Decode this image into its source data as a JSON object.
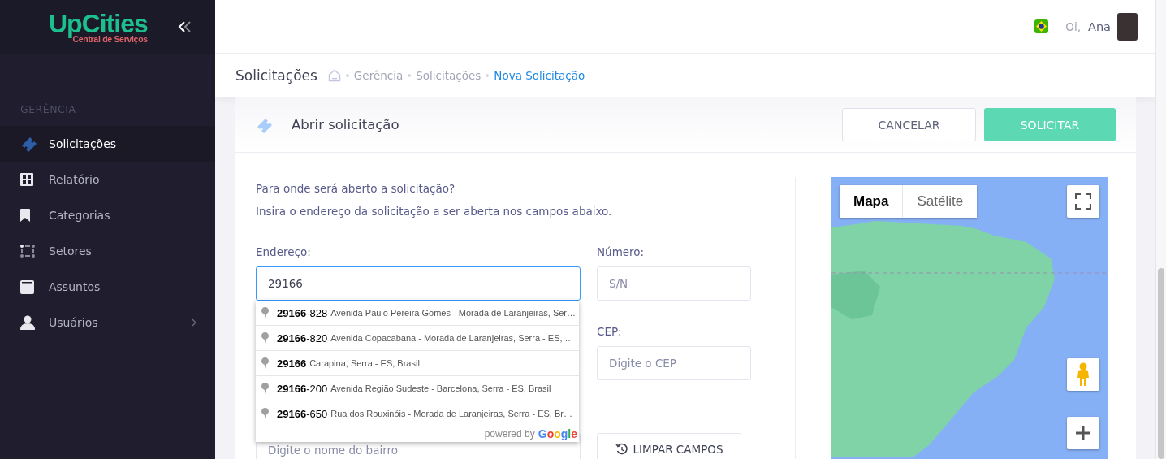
{
  "sidebar": {
    "logo": {
      "name": "UpCities",
      "tagline": "Central de Serviços"
    },
    "section_title": "GERÊNCIA",
    "items": [
      {
        "label": "Solicitações",
        "selected": true,
        "expandable": false
      },
      {
        "label": "Relatório",
        "selected": false,
        "expandable": false
      },
      {
        "label": "Categorias",
        "selected": false,
        "expandable": false
      },
      {
        "label": "Setores",
        "selected": false,
        "expandable": false
      },
      {
        "label": "Assuntos",
        "selected": false,
        "expandable": false
      },
      {
        "label": "Usuários",
        "selected": false,
        "expandable": true
      }
    ]
  },
  "header": {
    "greeting": "Oi,",
    "user_name": "Ana"
  },
  "breadcrumb": {
    "title": "Solicitações",
    "items": [
      {
        "label": "Gerência",
        "selected": false
      },
      {
        "label": "Solicitações",
        "selected": false
      },
      {
        "label": "Nova Solicitação",
        "selected": true
      }
    ]
  },
  "card": {
    "title": "Abrir solicitação",
    "buttons": [
      {
        "label": "CANCELAR",
        "kind": "secondary"
      },
      {
        "label": "SOLICITAR",
        "kind": "primary"
      }
    ],
    "intro": [
      "Para onde será aberto a solicitação?",
      "Insira o endereço da solicitação a ser aberta nos campos abaixo."
    ],
    "address": {
      "label": "Endereço:",
      "value": "29166"
    },
    "number": {
      "label": "Número:",
      "placeholder": "S/N"
    },
    "cep": {
      "label": "CEP:",
      "placeholder": "Digite o CEP"
    },
    "district": {
      "placeholder": "Digite o nome do bairro"
    },
    "clear_button": "LIMPAR CAMPOS",
    "suggestions": [
      {
        "main": "**29166**-828",
        "description": "Avenida Paulo Pereira Gomes - Morada de Laranjeiras, Ser…"
      },
      {
        "main": "**29166**-820",
        "description": "Avenida Copacabana - Morada de Laranjeiras, Serra - ES, …"
      },
      {
        "main": "**29166**",
        "description": "Carapina, Serra - ES, Brasil"
      },
      {
        "main": "**29166**-200",
        "description": "Avenida Região Sudeste - Barcelona, Serra - ES, Brasil"
      },
      {
        "main": "**29166**-650",
        "description": "Rua dos Rouxinóis - Morada de Laranjeiras, Serra - ES, Br…"
      }
    ],
    "powered_by": "powered by",
    "provider": "Google",
    "map": {
      "tabs": [
        {
          "label": "Mapa",
          "selected": true
        },
        {
          "label": "Satélite",
          "selected": false
        }
      ]
    }
  }
}
